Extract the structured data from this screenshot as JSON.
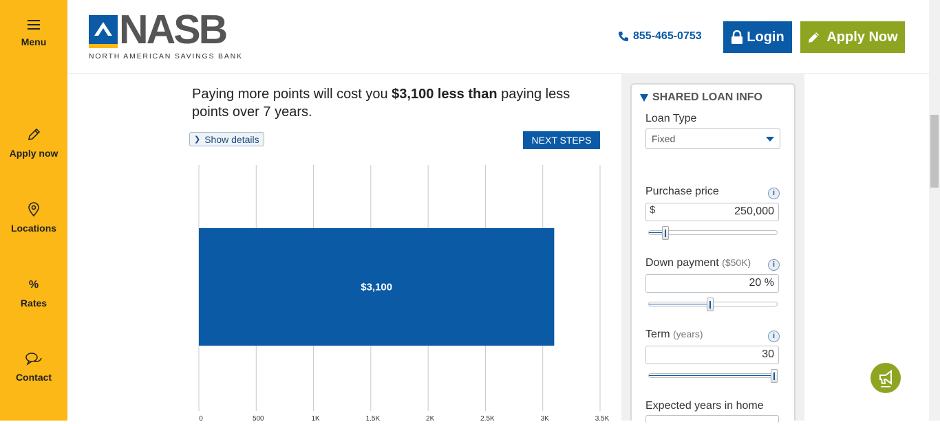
{
  "sidebar": {
    "items": [
      {
        "label": "Menu",
        "icon": "hamburger-icon"
      },
      {
        "label": "Apply now",
        "icon": "pencil-icon"
      },
      {
        "label": "Locations",
        "icon": "map-pin-icon"
      },
      {
        "label": "Rates",
        "icon": "percent-icon"
      },
      {
        "label": "Contact",
        "icon": "chat-bubbles-icon"
      }
    ]
  },
  "header": {
    "logo_word": "NASB",
    "logo_subtitle": "NORTH AMERICAN SAVINGS BANK",
    "phone": "855-465-0753",
    "login_label": "Login",
    "apply_label": "Apply Now"
  },
  "main": {
    "headline_pre": "Paying more points will cost you ",
    "headline_bold": "$3,100 less than",
    "headline_post": " paying less points over 7 years.",
    "show_details_label": "Show details",
    "next_steps_label": "NEXT STEPS"
  },
  "chart_data": {
    "type": "bar",
    "orientation": "horizontal",
    "categories": [
      ""
    ],
    "values": [
      3100
    ],
    "data_labels": [
      "$3,100"
    ],
    "x_ticks": [
      "0",
      "500",
      "1K",
      "1.5K",
      "2K",
      "2.5K",
      "3K",
      "3.5K"
    ],
    "xlim": [
      0,
      3500
    ],
    "grid": true,
    "bar_color": "#0a5aa6"
  },
  "panel": {
    "title": "SHARED LOAN INFO",
    "loan_type_label": "Loan Type",
    "loan_type_value": "Fixed",
    "purchase_price_label": "Purchase price",
    "purchase_price_prefix": "$",
    "purchase_price_value": "250,000",
    "purchase_price_slider": 0.11,
    "down_payment_label": "Down payment",
    "down_payment_sub": "($50K)",
    "down_payment_value": "20 %",
    "down_payment_slider": 0.48,
    "term_label": "Term",
    "term_sub": "(years)",
    "term_value": "30",
    "term_slider": 1.0,
    "expected_years_label": "Expected years in home",
    "info_glyph": "i"
  },
  "colors": {
    "sidebar": "#fbb817",
    "brand_blue": "#0a5aa6",
    "brand_green": "#8ea521"
  }
}
